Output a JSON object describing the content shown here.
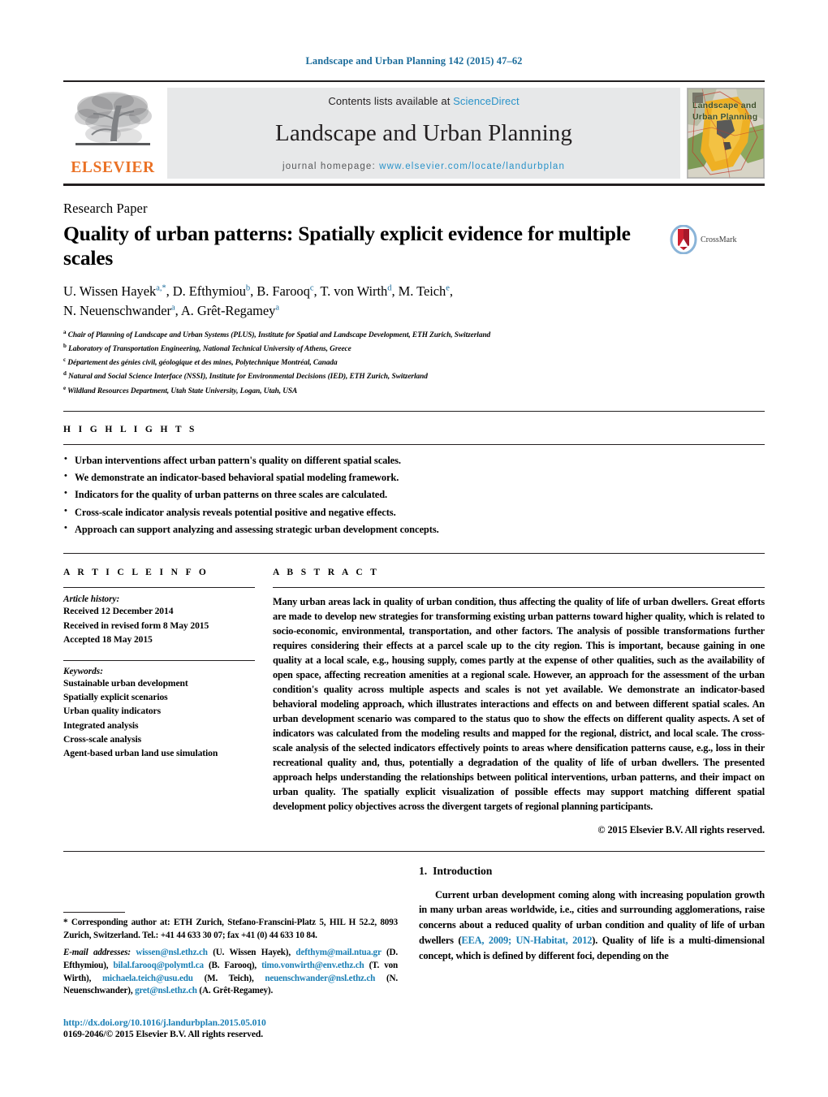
{
  "running_head": "Landscape and Urban Planning 142 (2015) 47–62",
  "masthead": {
    "contents_prefix": "Contents lists available at ",
    "sciencedirect": "ScienceDirect",
    "journal_name": "Landscape and Urban Planning",
    "homepage_prefix": "journal homepage: ",
    "homepage_url": "www.elsevier.com/locate/landurbplan",
    "publisher_wordmark": "ELSEVIER",
    "cover_title_line1": "Landscape and",
    "cover_title_line2": "Urban Planning",
    "accent_color": "#2a93c9",
    "elsevier_orange": "#ea7125"
  },
  "article": {
    "type": "Research Paper",
    "title": "Quality of urban patterns: Spatially explicit evidence for multiple scales",
    "crossmark_label": "CrossMark",
    "authors_line1": "U. Wissen Hayek",
    "authors": [
      {
        "name": "U. Wissen Hayek",
        "marks": "a,*"
      },
      {
        "name": "D. Efthymiou",
        "marks": "b"
      },
      {
        "name": "B. Farooq",
        "marks": "c"
      },
      {
        "name": "T. von Wirth",
        "marks": "d"
      },
      {
        "name": "M. Teich",
        "marks": "e"
      },
      {
        "name": "N. Neuenschwander",
        "marks": "a"
      },
      {
        "name": "A. Grêt-Regamey",
        "marks": "a"
      }
    ],
    "affiliations": [
      {
        "mark": "a",
        "text": "Chair of Planning of Landscape and Urban Systems (PLUS), Institute for Spatial and Landscape Development, ETH Zurich, Switzerland"
      },
      {
        "mark": "b",
        "text": "Laboratory of Transportation Engineering, National Technical University of Athens, Greece"
      },
      {
        "mark": "c",
        "text": "Département des génies civil, géologique et des mines, Polytechnique Montréal, Canada"
      },
      {
        "mark": "d",
        "text": "Natural and Social Science Interface (NSSI), Institute for Environmental Decisions (IED), ETH Zurich, Switzerland"
      },
      {
        "mark": "e",
        "text": "Wildland Resources Department, Utah State University, Logan, Utah, USA"
      }
    ]
  },
  "highlights": {
    "heading": "H I G H L I G H T S",
    "items": [
      "Urban interventions affect urban pattern's quality on different spatial scales.",
      "We demonstrate an indicator-based behavioral spatial modeling framework.",
      "Indicators for the quality of urban patterns on three scales are calculated.",
      "Cross-scale indicator analysis reveals potential positive and negative effects.",
      "Approach can support analyzing and assessing strategic urban development concepts."
    ]
  },
  "article_info": {
    "heading": "A R T I C L E    I N F O",
    "history_label": "Article history:",
    "history": [
      "Received 12 December 2014",
      "Received in revised form 8 May 2015",
      "Accepted 18 May 2015"
    ],
    "keywords_label": "Keywords:",
    "keywords": [
      "Sustainable urban development",
      "Spatially explicit scenarios",
      "Urban quality indicators",
      "Integrated analysis",
      "Cross-scale analysis",
      "Agent-based urban land use simulation"
    ]
  },
  "abstract": {
    "heading": "A B S T R A C T",
    "text": "Many urban areas lack in quality of urban condition, thus affecting the quality of life of urban dwellers. Great efforts are made to develop new strategies for transforming existing urban patterns toward higher quality, which is related to socio-economic, environmental, transportation, and other factors. The analysis of possible transformations further requires considering their effects at a parcel scale up to the city region. This is important, because gaining in one quality at a local scale, e.g., housing supply, comes partly at the expense of other qualities, such as the availability of open space, affecting recreation amenities at a regional scale. However, an approach for the assessment of the urban condition's quality across multiple aspects and scales is not yet available. We demonstrate an indicator-based behavioral modeling approach, which illustrates interactions and effects on and between different spatial scales. An urban development scenario was compared to the status quo to show the effects on different quality aspects. A set of indicators was calculated from the modeling results and mapped for the regional, district, and local scale. The cross-scale analysis of the selected indicators effectively points to areas where densification patterns cause, e.g., loss in their recreational quality and, thus, potentially a degradation of the quality of life of urban dwellers. The presented approach helps understanding the relationships between political interventions, urban patterns, and their impact on urban quality. The spatially explicit visualization of possible effects may support matching different spatial development policy objectives across the divergent targets of regional planning participants.",
    "copyright": "© 2015 Elsevier B.V. All rights reserved."
  },
  "footnote": {
    "corresponding_marker": "*",
    "corresponding_text": " Corresponding author at: ETH Zurich, Stefano-Franscini-Platz 5, HIL H 52.2, 8093 Zurich, Switzerland. Tel.: +41 44 633 30 07; fax +41 (0) 44 633 10 84.",
    "email_label": "E-mail addresses:",
    "emails": [
      {
        "address": "wissen@nsl.ethz.ch",
        "person": "(U. Wissen Hayek)"
      },
      {
        "address": "defthym@mail.ntua.gr",
        "person": "(D. Efthymiou)"
      },
      {
        "address": "bilal.farooq@polymtl.ca",
        "person": "(B. Farooq)"
      },
      {
        "address": "timo.vonwirth@env.ethz.ch",
        "person": "(T. von Wirth)"
      },
      {
        "address": "michaela.teich@usu.edu",
        "person": "(M. Teich)"
      },
      {
        "address": "neuenschwander@nsl.ethz.ch",
        "person": "(N. Neuenschwander)"
      },
      {
        "address": "gret@nsl.ethz.ch",
        "person": "(A. Grêt-Regamey)"
      }
    ],
    "doi": "http://dx.doi.org/10.1016/j.landurbplan.2015.05.010",
    "issn_copyright": "0169-2046/© 2015 Elsevier B.V. All rights reserved."
  },
  "introduction": {
    "number": "1.",
    "heading": "Introduction",
    "paragraph_part1": "Current urban development coming along with increasing population growth in many urban areas worldwide, i.e., cities and surrounding agglomerations, raise concerns about a reduced quality of urban condition and quality of life of urban dwellers (",
    "citation": "EEA, 2009; UN-Habitat, 2012",
    "paragraph_part2": "). Quality of life is a multi-dimensional concept, which is defined by different foci, depending on the"
  }
}
